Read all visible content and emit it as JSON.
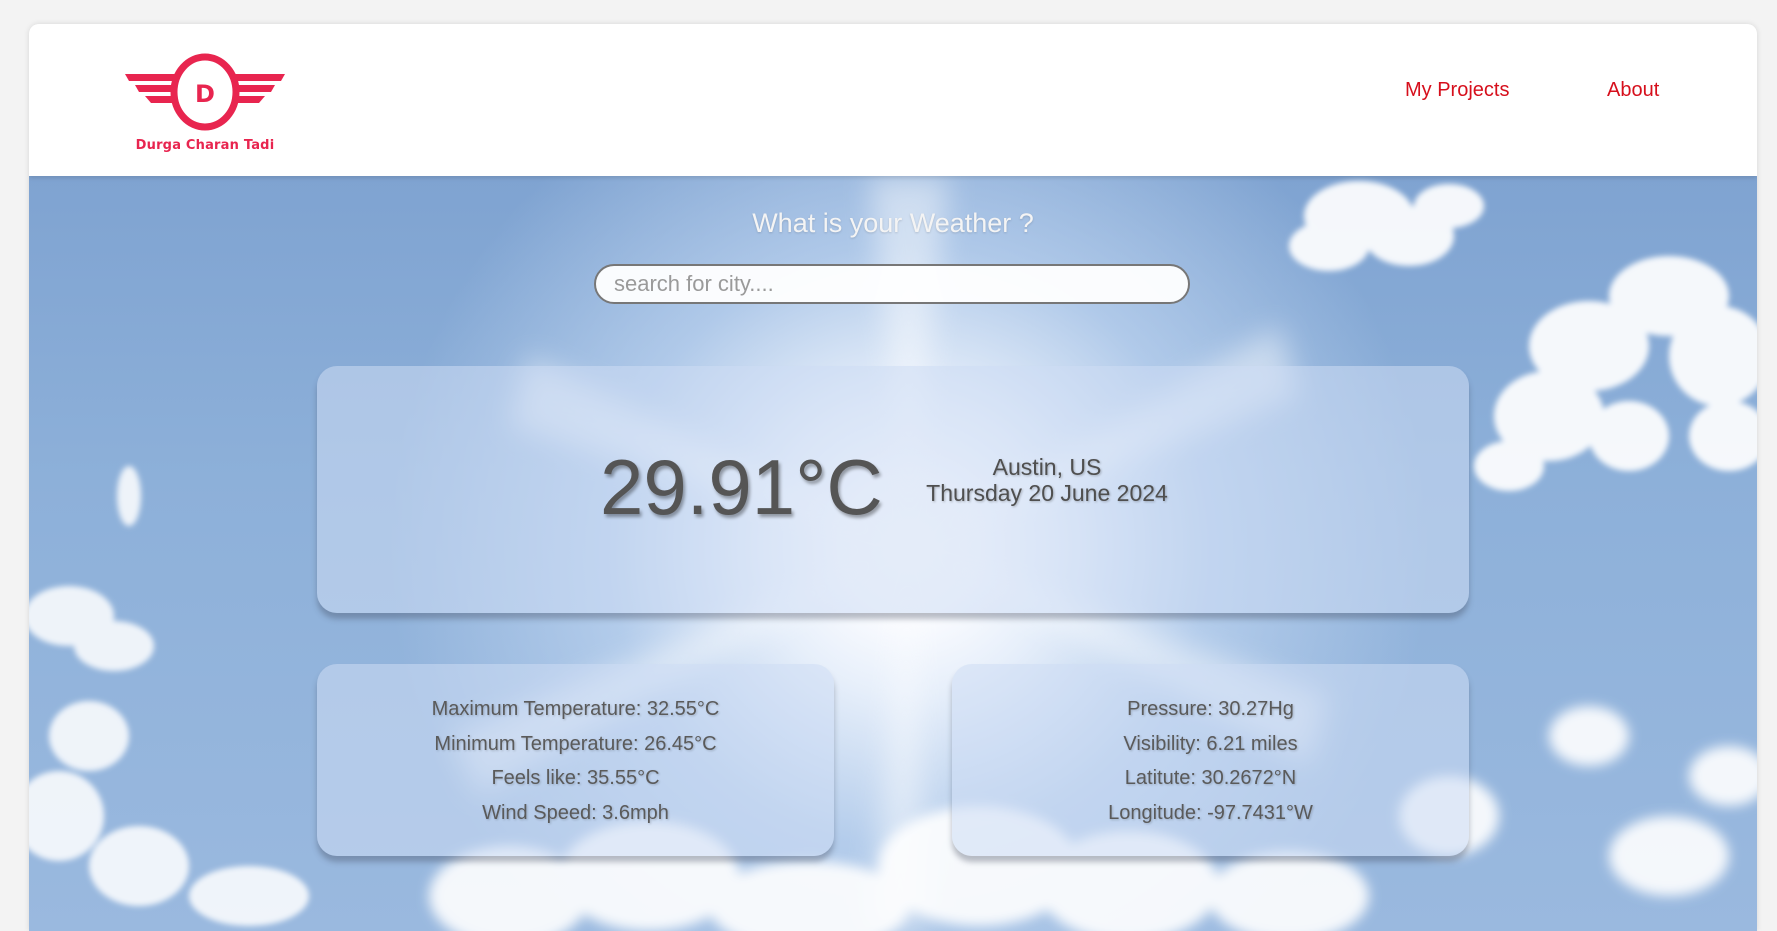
{
  "brand": {
    "logo_letter": "D",
    "name": "Durga Charan Tadi"
  },
  "nav": {
    "projects": "My Projects",
    "about": "About"
  },
  "colors": {
    "brand_pink": "#e8254f",
    "nav_link_red": "#d60f1c"
  },
  "weather": {
    "heading": "What is your Weather ?",
    "search_placeholder": "search for city....",
    "temperature": "29.91°C",
    "location": "Austin, US",
    "date": "Thursday 20 June 2024",
    "left_details": [
      "Maximum Temperature: 32.55°C",
      "Minimum Temperature: 26.45°C",
      "Feels like: 35.55°C",
      "Wind Speed: 3.6mph"
    ],
    "right_details": [
      "Pressure: 30.27Hg",
      "Visibility: 6.21 miles",
      "Latitute: 30.2672°N",
      "Longitude: -97.7431°W"
    ]
  }
}
